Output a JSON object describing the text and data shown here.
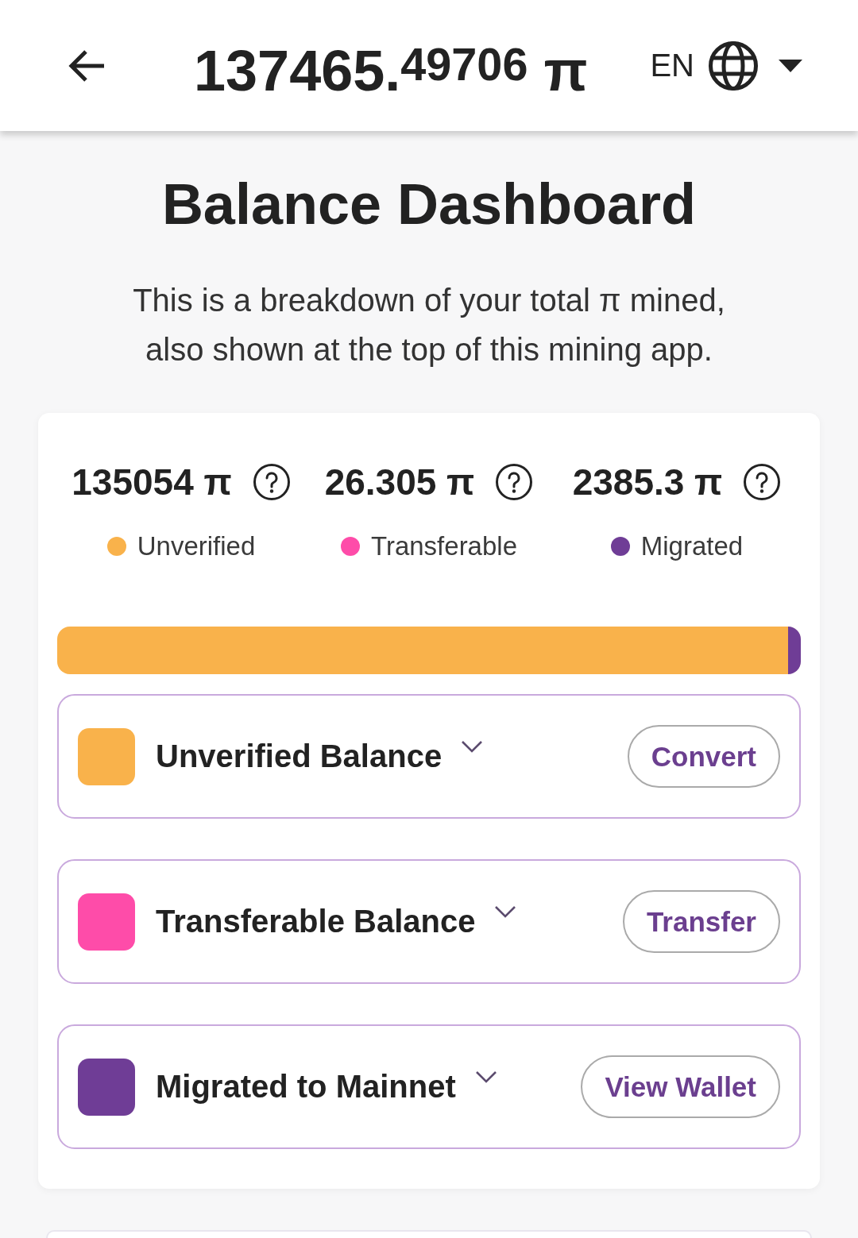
{
  "header": {
    "balance": "137465.$^{49706}$ π",
    "language": "EN"
  },
  "title": "Balance Dashboard",
  "description": "This is a breakdown of your total π mined, also shown at the top of this mining app.",
  "balances": [
    {
      "amount": "135054 π",
      "label": "Unverified",
      "color": "#f9b24b",
      "level": 0.9824
    },
    {
      "amount": "26.305 π",
      "label": "Transferable",
      "color": "#fe4ca9"
    },
    {
      "amount": "2385.3 π",
      "label": "Migrated",
      "color": "#6f3d96",
      "level": 0.0174
    }
  ],
  "sections": [
    {
      "title": "Unverified Balance",
      "action": "Convert",
      "color": "#f9b24b",
      "expanded": false
    },
    {
      "title": "Transferable Balance",
      "action": "Transfer",
      "color": "#fe4ca9",
      "expanded": false
    },
    {
      "title": "Migrated to Mainnet",
      "action": "View Wallet",
      "color": "#6f3d96",
      "expanded": false
    }
  ]
}
